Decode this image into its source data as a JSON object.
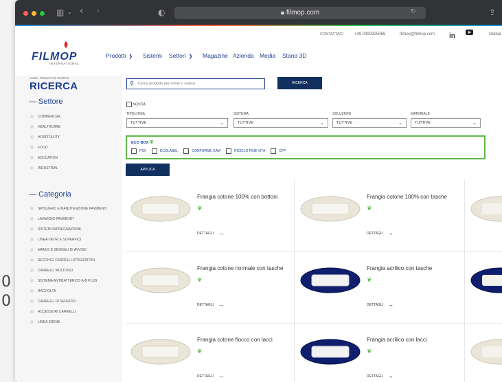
{
  "backdrop": {
    "digits": [
      "0",
      "0"
    ]
  },
  "browser": {
    "url": "filmop.com"
  },
  "topbar": {
    "contact_label": "CONTATTACI",
    "phone": "+39 0499325066",
    "email": "filmop@filmop.com",
    "linkedin": "in",
    "language": "Global"
  },
  "logo": {
    "name": "FILMOP",
    "sub": "INTERNATIONAL"
  },
  "nav": [
    {
      "label": "Prodotti",
      "dropdown": true
    },
    {
      "label": "Sistemi",
      "dropdown": false
    },
    {
      "label": "Settori",
      "dropdown": true
    },
    {
      "label": "Magazine",
      "dropdown": false
    },
    {
      "label": "Azienda",
      "dropdown": false
    },
    {
      "label": "Media",
      "dropdown": false
    },
    {
      "label": "Stand 3D",
      "dropdown": false
    }
  ],
  "breadcrumb": "HOME • PRODOTTI DI RICERCA",
  "page_title": "RICERCA",
  "search": {
    "placeholder": "Cerca prodotto per nome o codice",
    "button": "RICERCA"
  },
  "sidebar": {
    "settore_title": "— Settore",
    "settore": [
      "COMMERCIAL",
      "HEALTHCARE",
      "HOSPITALITY",
      "FOOD",
      "EDUCATION",
      "INDUSTRIAL"
    ],
    "categoria_title": "— Categoria",
    "categoria": [
      "SPOLVERO E MANUTENZIONE PAVIMENTI",
      "LAVAGGIO PAVIMENTI",
      "SISTEMI IMPREGNAZIONE",
      "LINEA VETRI E SUPERFICI",
      "MANICI E SEGNALI DI AVVISO",
      "SECCHI E CARRELLI STRIZZATORI",
      "CARRELLI MULTIUSO",
      "SISTEMA ANTIBATTERICO A-B PLUS",
      "RACCOLTA",
      "CARRELLI DI SERVIZIO",
      "ACCESSORI CARRELLI",
      "LINEA IGIENE"
    ]
  },
  "filters": {
    "novita": "NOVITÀ",
    "tipologia": {
      "label": "TIPOLOGIA",
      "value": "TUTTIVE"
    },
    "sistema": {
      "label": "SISTEMA",
      "value": "TUTTIVE"
    },
    "soluzioni": {
      "label": "SOLUZIONI",
      "value": "TUTTIVE"
    },
    "materiale": {
      "label": "MATERIALE",
      "value": "TUTTIVE"
    },
    "ecobox": {
      "title": "ECO BOX",
      "items": [
        "PSV",
        "ECOLABEL",
        "CONFORME CAM",
        "RICICLO FINE VITA",
        "CFP"
      ]
    },
    "apply": "APPLICA"
  },
  "product_link": "DETTAGLI",
  "products": [
    {
      "title": "Frangia cotone 100% con bottoni",
      "color": "#e9e5d9"
    },
    {
      "title": "Frangia cotone 100% con tasche",
      "color": "#e9e5d9"
    },
    {
      "title": "Frangia cotone normale con tasche",
      "color": "#e9e5d9"
    },
    {
      "title": "Frangia acrilico con tasche",
      "color": "#0f1f6e"
    },
    {
      "title": "Frangia cotone fiocco con lacci",
      "color": "#e9e5d9"
    },
    {
      "title": "Frangia acrilico con lacci",
      "color": "#0f1f6e"
    }
  ],
  "colors": {
    "brand": "#1c3f8f",
    "button": "#12305f",
    "eco_green": "#5fb847"
  }
}
